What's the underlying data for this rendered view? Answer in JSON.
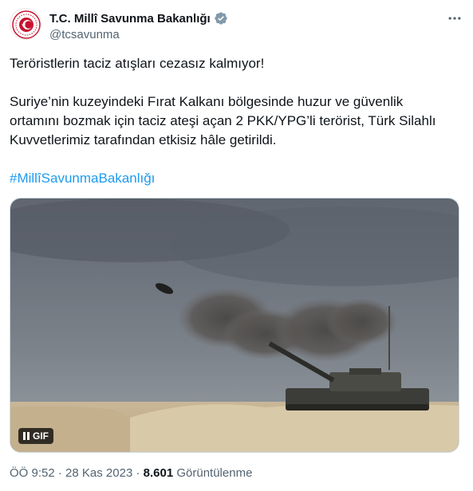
{
  "account": {
    "name": "T.C. Millî Savunma Bakanlığı",
    "handle": "@tcsavunma",
    "avatar_icon": "ministry-emblem-icon",
    "verified_icon": "verified-gray-badge-icon",
    "verified_color": "#829aab"
  },
  "tweet": {
    "line1": "Teröristlerin taciz atışları cezasız kalmıyor!",
    "line2": "Suriye’nin kuzeyindeki Fırat Kalkanı bölgesinde huzur ve güvenlik ortamını bozmak için taciz ateşi açan 2 PKK/YPG’li terörist, Türk Silahlı Kuvvetlerimiz tarafından etkisiz hâle getirildi.",
    "hashtag": "#MillîSavunmaBakanlığı"
  },
  "media": {
    "type_label": "GIF",
    "pause_icon": "pause-icon"
  },
  "meta": {
    "time": "ÖÖ 9:52",
    "separator": "·",
    "date": "28 Kas 2023",
    "views_count": "8.601",
    "views_label": "Görüntülenme"
  },
  "colors": {
    "accent": "#1d9bf0",
    "secondary_text": "#536471",
    "emblem_red": "#c8102e"
  }
}
